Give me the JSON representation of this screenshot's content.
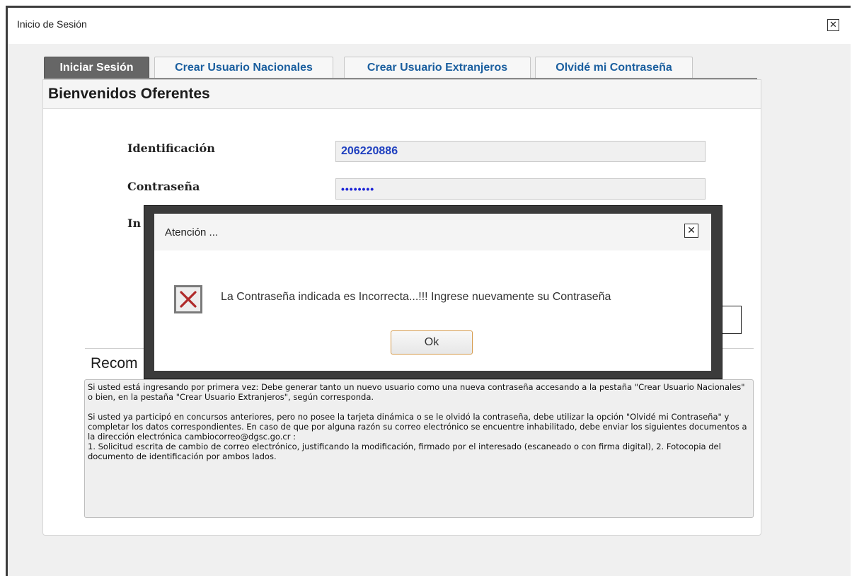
{
  "window": {
    "title": "Inicio de Sesión",
    "close_glyph": "✕"
  },
  "tabs": [
    {
      "label": "Iniciar Sesión",
      "active": true
    },
    {
      "label": "Crear Usuario Nacionales",
      "active": false
    },
    {
      "label": "Crear Usuario Extranjeros",
      "active": false
    },
    {
      "label": "Olvidé mi Contraseña",
      "active": false
    }
  ],
  "panel": {
    "title": "Bienvenidos Oferentes"
  },
  "form": {
    "id_label": "Identificación",
    "id_value": "206220886",
    "password_label": "Contraseña",
    "password_mask": "••••••••",
    "partial_label": "In"
  },
  "recommendations": {
    "title_partial": "Recom",
    "paragraph1": "Si usted está ingresando por primera vez: Debe generar tanto un nuevo usuario como una nueva contraseña accesando a la pestaña \"Crear Usuario Nacionales\" o bien, en la pestaña \"Crear Usuario Extranjeros\", según corresponda.",
    "paragraph2": "Si usted ya participó en concursos anteriores, pero no posee la tarjeta dinámica o se le olvidó la contraseña, debe utilizar la opción \"Olvidé mi Contraseña\" y completar los datos correspondientes. En caso de que por alguna razón su correo electrónico se encuentre inhabilitado, debe enviar los siguientes documentos  a la dirección electrónica cambiocorreo@dgsc.go.cr :",
    "paragraph3": "1. Solicitud escrita de cambio de correo electrónico, justificando la modificación, firmado por el interesado (escaneado o con firma digital), 2. Fotocopia del documento de identificación por ambos lados."
  },
  "modal": {
    "title": "Atención ...",
    "close_glyph": "✕",
    "icon": "error-x-icon",
    "message": "La Contraseña indicada es Incorrecta...!!! Ingrese nuevamente su Contraseña",
    "ok_label": "Ok"
  },
  "colors": {
    "tab_active_bg": "#666666",
    "tab_text": "#1b5f9f",
    "input_text": "#1e3fbf",
    "error_x": "#b02a2a",
    "ok_border": "#d59a4c"
  }
}
